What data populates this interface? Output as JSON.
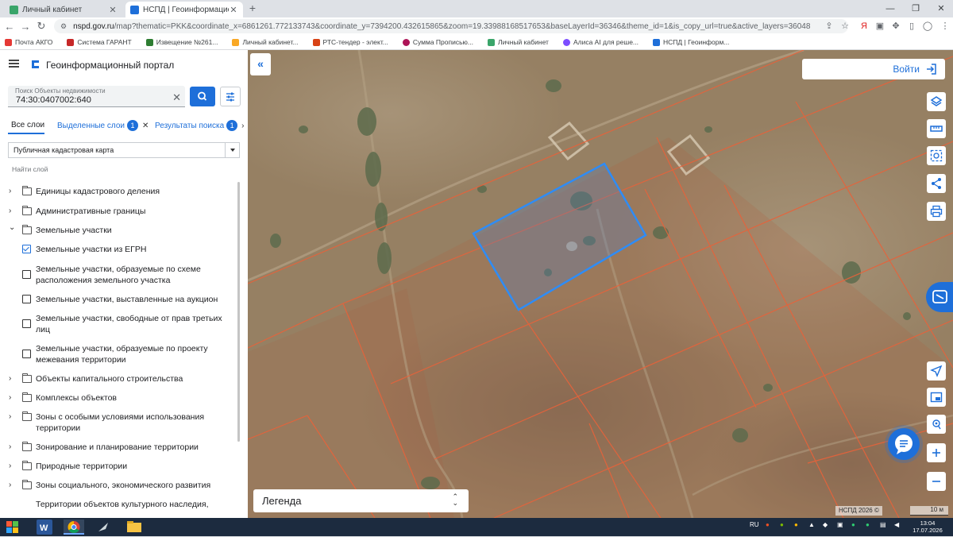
{
  "browser": {
    "tabs": [
      {
        "label": "Личный кабинет",
        "active": false
      },
      {
        "label": "НСПД | Геоинформационный п",
        "active": true
      }
    ],
    "url_host": "nspd.gov.ru",
    "url_rest": "/map?thematic=PKK&coordinate_x=6861261.772133743&coordinate_y=7394200.432615865&zoom=19.33988168517653&baseLayerId=36346&theme_id=1&is_copy_url=true&active_layers=36048",
    "bookmarks": [
      "Почта АКГО",
      "Система ГАРАНТ",
      "Извещение №261...",
      "Личный кабинет...",
      "РТС-тендер - элект...",
      "Сумма Прописью...",
      "Личный кабинет",
      "Алиса AI для реше...",
      "НСПД | Геоинформ..."
    ]
  },
  "portal": {
    "title": "Геоинформационный портал",
    "search": {
      "placeholder": "Поиск Объекты недвижимости",
      "value": "74:30:0407002:640"
    },
    "tabs": {
      "all_layers": "Все слои",
      "selected_layers": "Выделенные слои",
      "selected_count": "1",
      "search_results": "Результаты поиска",
      "results_count": "1"
    },
    "base_map": "Публичная кадастровая карта",
    "find_layer": "Найти слой",
    "layers": [
      {
        "type": "folder",
        "chevron": "›",
        "label": "Единицы кадастрового деления"
      },
      {
        "type": "folder",
        "chevron": "›",
        "label": "Административные границы"
      },
      {
        "type": "folder",
        "chevron": "⌄",
        "label": "Земельные участки"
      },
      {
        "type": "check",
        "checked": true,
        "label": "Земельные участки из ЕГРН"
      },
      {
        "type": "check",
        "checked": false,
        "label": "Земельные участки, образуемые по схеме расположения земельного участка"
      },
      {
        "type": "check",
        "checked": false,
        "label": "Земельные участки, выставленные на аукцион"
      },
      {
        "type": "check",
        "checked": false,
        "label": "Земельные участки, свободные от прав третьих лиц"
      },
      {
        "type": "check",
        "checked": false,
        "label": "Земельные участки, образуемые по проекту межевания территории"
      },
      {
        "type": "folder",
        "chevron": "›",
        "label": "Объекты капитального строительства"
      },
      {
        "type": "folder",
        "chevron": "›",
        "label": "Комплексы объектов"
      },
      {
        "type": "folder",
        "chevron": "›",
        "label": "Зоны с особыми условиями использования территории"
      },
      {
        "type": "folder",
        "chevron": "›",
        "label": "Зонирование и планирование территории"
      },
      {
        "type": "folder",
        "chevron": "›",
        "label": "Природные территории"
      },
      {
        "type": "folder",
        "chevron": "›",
        "label": "Зоны социального, экономического развития"
      },
      {
        "type": "text",
        "label": "Территории объектов культурного наследия,"
      }
    ]
  },
  "map": {
    "login": "Войти",
    "legend": "Легенда",
    "attribution": "НСПД 2026 ©",
    "scale": "10 м",
    "colors": {
      "accent": "#1e6fd9",
      "parcel_line": "#e8623a",
      "selected": "#2f8cf5"
    }
  },
  "taskbar": {
    "lang": "RU",
    "time": "13:04",
    "date": "17.07.2026"
  }
}
